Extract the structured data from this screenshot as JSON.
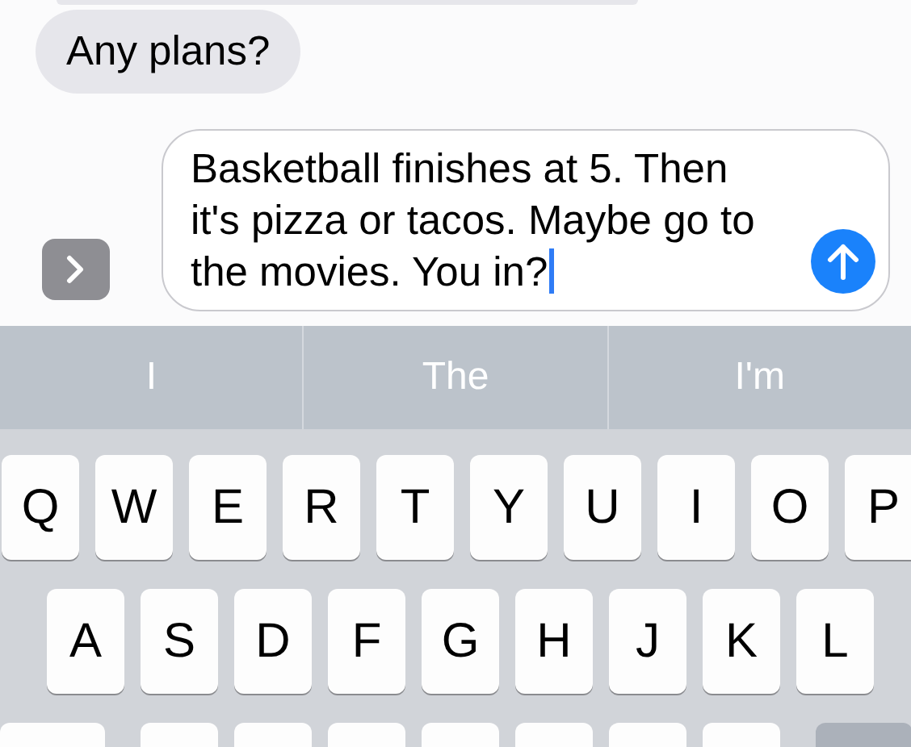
{
  "messages": [
    {
      "kind": "received",
      "text": "Any plans?"
    }
  ],
  "composer": {
    "value": "Basketball finishes at 5. Then it's pizza or tacos. Maybe go to the movies. You in?",
    "focused": true
  },
  "predictions": [
    "I",
    "The",
    "I'm"
  ],
  "keyboard": {
    "rows": [
      [
        "Q",
        "W",
        "E",
        "R",
        "T",
        "Y",
        "U",
        "I",
        "O",
        "P"
      ],
      [
        "A",
        "S",
        "D",
        "F",
        "G",
        "H",
        "J",
        "K",
        "L"
      ]
    ]
  }
}
